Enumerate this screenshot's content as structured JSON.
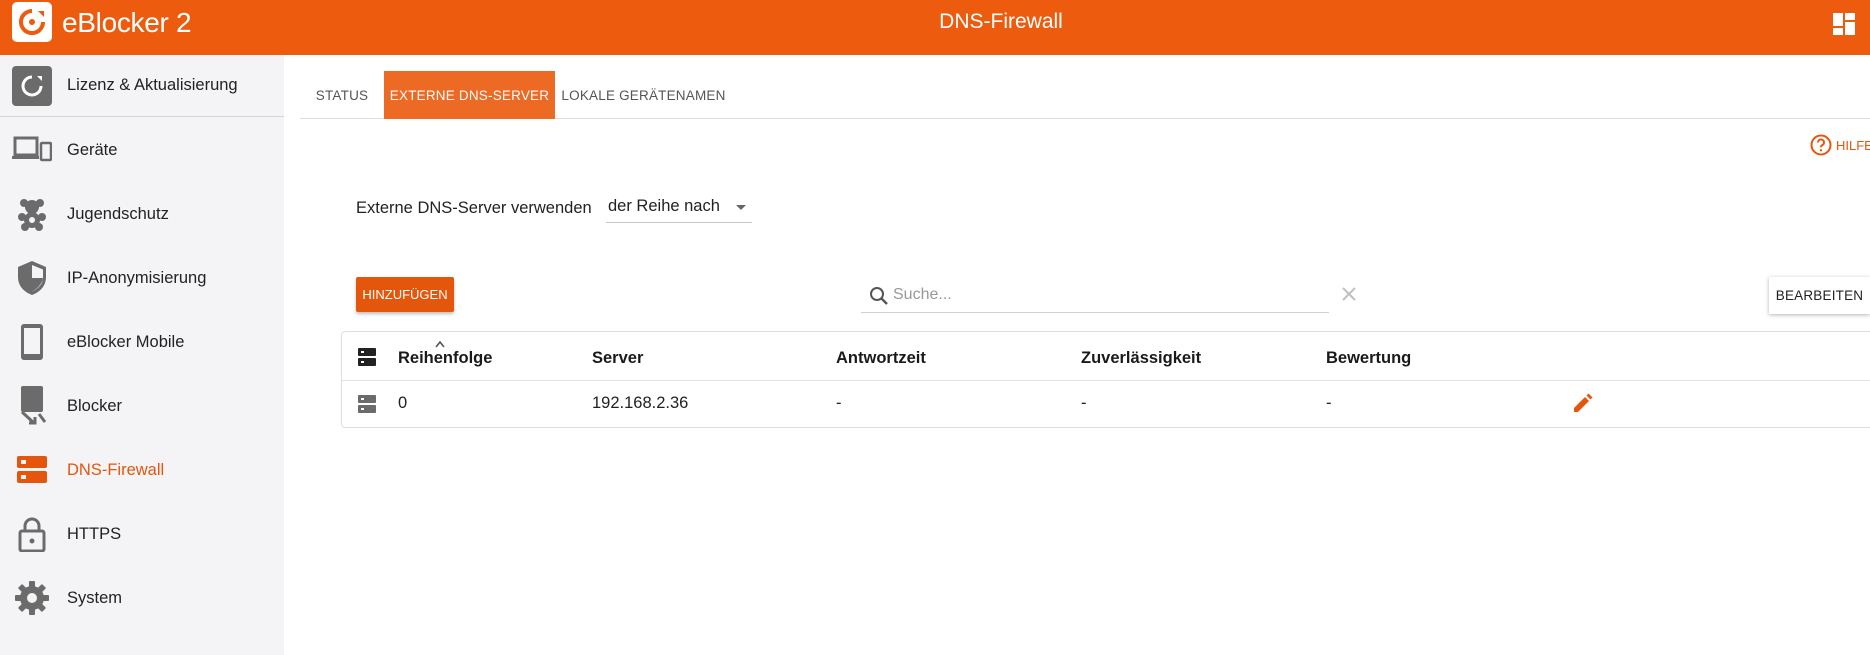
{
  "app": {
    "brand": "eBlocker 2",
    "page_title": "DNS-Firewall",
    "accent": "#ec5b0e"
  },
  "sidebar": {
    "items": [
      {
        "label": "Lizenz & Aktualisierung",
        "icon": "refresh-icon"
      },
      {
        "label": "Geräte",
        "icon": "devices-icon"
      },
      {
        "label": "Jugendschutz",
        "icon": "teddy-bear-icon"
      },
      {
        "label": "IP-Anonymisierung",
        "icon": "shield-icon"
      },
      {
        "label": "eBlocker Mobile",
        "icon": "phone-icon"
      },
      {
        "label": "Blocker",
        "icon": "blocker-icon"
      },
      {
        "label": "DNS-Firewall",
        "icon": "dns-server-icon",
        "active": true
      },
      {
        "label": "HTTPS",
        "icon": "lock-icon"
      },
      {
        "label": "System",
        "icon": "gear-icon"
      }
    ]
  },
  "tabs": [
    {
      "label": "STATUS"
    },
    {
      "label": "EXTERNE DNS-SERVER",
      "active": true
    },
    {
      "label": "LOKALE GERÄTENAMEN"
    }
  ],
  "help_label": "HILFE",
  "mode": {
    "label": "Externe DNS-Server verwenden",
    "value": "der Reihe nach"
  },
  "toolbar": {
    "add_label": "HINZUFÜGEN",
    "search_placeholder": "Suche...",
    "edit_label": "BEARBEITEN"
  },
  "table": {
    "columns": [
      "Reihenfolge",
      "Server",
      "Antwortzeit",
      "Zuverlässigkeit",
      "Bewertung"
    ],
    "rows": [
      {
        "order": "0",
        "server": "192.168.2.36",
        "response": "-",
        "reliability": "-",
        "rating": "-"
      }
    ]
  }
}
